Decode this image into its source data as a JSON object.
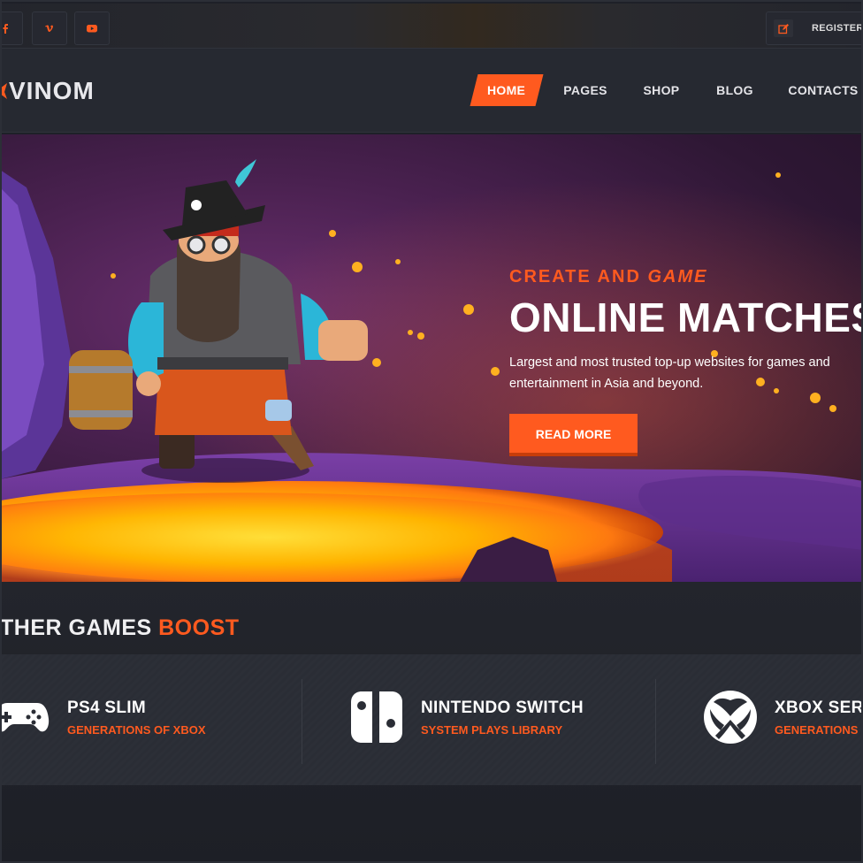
{
  "topbar": {
    "social": [
      {
        "name": "facebook",
        "glyph": "f"
      },
      {
        "name": "vimeo",
        "glyph": "v"
      },
      {
        "name": "youtube",
        "glyph": "yt"
      }
    ],
    "register_label": "REGISTER"
  },
  "header": {
    "logo_text": "VINOM",
    "nav": [
      "HOME",
      "PAGES",
      "SHOP",
      "BLOG",
      "CONTACTS"
    ],
    "active": "HOME"
  },
  "hero": {
    "kicker_part1": "CREATE AND ",
    "kicker_part2": "GAME",
    "title": "ONLINE MATCHES",
    "description": "Largest and most trusted top-up websites for games and entertainment in Asia and beyond.",
    "button_label": "READ MORE"
  },
  "games": {
    "title_part1": "THER GAMES ",
    "title_part2": "BOOST",
    "items": [
      {
        "name": "PS4 SLIM",
        "subtitle": "GENERATIONS OF XBOX",
        "icon": "gamepad-icon"
      },
      {
        "name": "NINTENDO SWITCH",
        "subtitle": "SYSTEM PLAYS LIBRARY",
        "icon": "nintendo-switch-icon"
      },
      {
        "name": "XBOX SERI",
        "subtitle": "GENERATIONS",
        "icon": "xbox-icon"
      }
    ]
  },
  "colors": {
    "accent": "#ff5a1f",
    "background": "#1e2028",
    "header_bg": "#262931"
  }
}
